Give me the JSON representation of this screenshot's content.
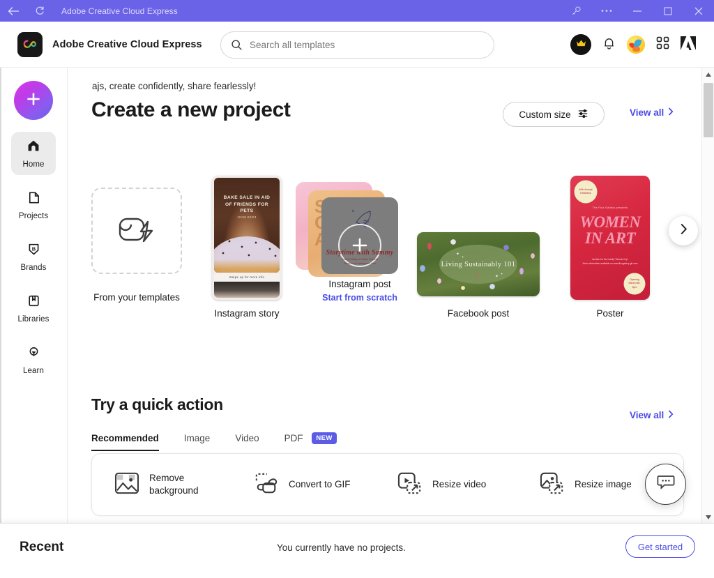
{
  "window": {
    "title": "Adobe Creative Cloud Express",
    "titlebar_color": "#6a63e8",
    "back_icon": "back-arrow-icon",
    "refresh_icon": "refresh-icon",
    "key_icon": "key-icon",
    "more_icon": "more-options-icon",
    "minimize_icon": "minimize-icon",
    "maximize_icon": "maximize-icon",
    "close_icon": "close-icon"
  },
  "header": {
    "brand": "Adobe Creative Cloud Express",
    "logo_icon": "creative-cloud-express-logo-icon",
    "search": {
      "placeholder": "Search all templates",
      "value": "",
      "icon": "search-icon"
    },
    "premium_icon": "crown-icon",
    "notifications_icon": "bell-icon",
    "avatar_icon": "user-avatar",
    "apps_icon": "app-grid-icon",
    "adobe_icon": "adobe-logo-icon"
  },
  "sidebar": {
    "new_button_label": "+",
    "new_button_icon": "plus-icon",
    "items": [
      {
        "label": "Home",
        "icon": "home-icon",
        "active": true
      },
      {
        "label": "Projects",
        "icon": "projects-file-icon",
        "active": false
      },
      {
        "label": "Brands",
        "icon": "brands-shield-icon",
        "active": false
      },
      {
        "label": "Libraries",
        "icon": "libraries-book-icon",
        "active": false
      },
      {
        "label": "Learn",
        "icon": "learn-lightbulb-icon",
        "active": false
      }
    ]
  },
  "main": {
    "greeting": "ajs, create confidently, share fearlessly!",
    "page_title": "Create a new project",
    "custom_size_label": "Custom size",
    "custom_size_icon": "sliders-icon",
    "view_all_label": "View all",
    "view_all_chevron": "chevron-right-icon",
    "next_arrow_icon": "chevron-right-icon",
    "cards": [
      {
        "caption": "From your templates",
        "subcaption": "",
        "icon": "template-bolt-icon"
      },
      {
        "caption": "Instagram story",
        "subcaption": "",
        "thumb_headline": "Bake sale in aid of friends for pets",
        "thumb_sub": "10AM 03/04",
        "thumb_swipe": "Swipe up for more info"
      },
      {
        "caption": "Instagram post",
        "subcaption": "Start from scratch",
        "thumb_headline": "Storytime with Sammy",
        "thumb_sub_1": "Every Friday at 10am Central",
        "thumb_sub_2": "Tune in on Instagram Live",
        "overlay_icon": "plus-circle-icon"
      },
      {
        "caption": "Facebook post",
        "subcaption": "",
        "thumb_headline": "Living Sustainably 101"
      },
      {
        "caption": "Poster",
        "subcaption": "",
        "seal_top": "40th Annual Exhibition",
        "presents": "The Flux Gallery presents",
        "thumb_headline_1": "WOMEN",
        "thumb_headline_2": "IN ART",
        "foot_1": "Auction for the charity \"Women Up\"",
        "foot_2": "More information available on www.fluxgallery-gb.com",
        "seal_bottom": "Opening March 8th, 9pm"
      }
    ]
  },
  "quick_action": {
    "title": "Try a quick action",
    "view_all_label": "View all",
    "tabs": [
      {
        "label": "Recommended",
        "active": true,
        "badge": ""
      },
      {
        "label": "Image",
        "active": false,
        "badge": ""
      },
      {
        "label": "Video",
        "active": false,
        "badge": ""
      },
      {
        "label": "PDF",
        "active": false,
        "badge": "NEW"
      }
    ],
    "items": [
      {
        "label": "Remove background",
        "icon": "remove-background-icon"
      },
      {
        "label": "Convert to GIF",
        "icon": "convert-to-gif-icon"
      },
      {
        "label": "Resize video",
        "icon": "resize-video-icon"
      },
      {
        "label": "Resize image",
        "icon": "resize-image-icon"
      }
    ]
  },
  "recent": {
    "title": "Recent",
    "empty_message": "You currently have no projects.",
    "get_started_label": "Get started"
  },
  "chat": {
    "icon": "chat-bubble-icon"
  },
  "scrollbar": {
    "up_icon": "scroll-up-icon",
    "down_icon": "scroll-down-icon"
  },
  "colors": {
    "titlebar": "#6a63e8",
    "accent_link": "#4a4ae8",
    "badge_new": "#5b5be6",
    "text_primary": "#1b1b1b"
  }
}
